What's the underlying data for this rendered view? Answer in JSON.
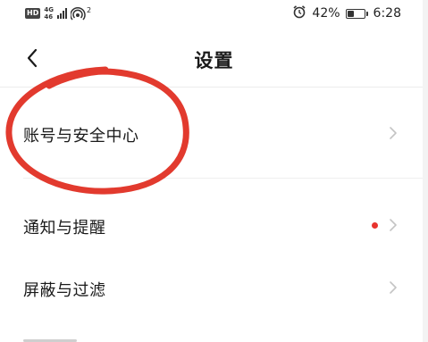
{
  "status_bar": {
    "hd": "HD",
    "network_top": "4G",
    "network_bottom": "46",
    "hotspot_count": "2",
    "battery_percent": "42%",
    "battery_level": 0.42,
    "time": "6:28",
    "icons": [
      "hd-icon",
      "signal-icon",
      "hotspot-icon",
      "alarm-icon",
      "battery-icon"
    ]
  },
  "header": {
    "back_icon": "chevron-left-icon",
    "title": "设置"
  },
  "settings": {
    "items": [
      {
        "label": "账号与安全中心",
        "has_badge": false,
        "icon": "chevron-right-icon"
      },
      {
        "label": "通知与提醒",
        "has_badge": true,
        "badge_color": "#e8332e",
        "icon": "chevron-right-icon"
      },
      {
        "label": "屏蔽与过滤",
        "has_badge": false,
        "icon": "chevron-right-icon"
      }
    ]
  },
  "annotation": {
    "shape": "ellipse",
    "color": "#e23a2e"
  }
}
